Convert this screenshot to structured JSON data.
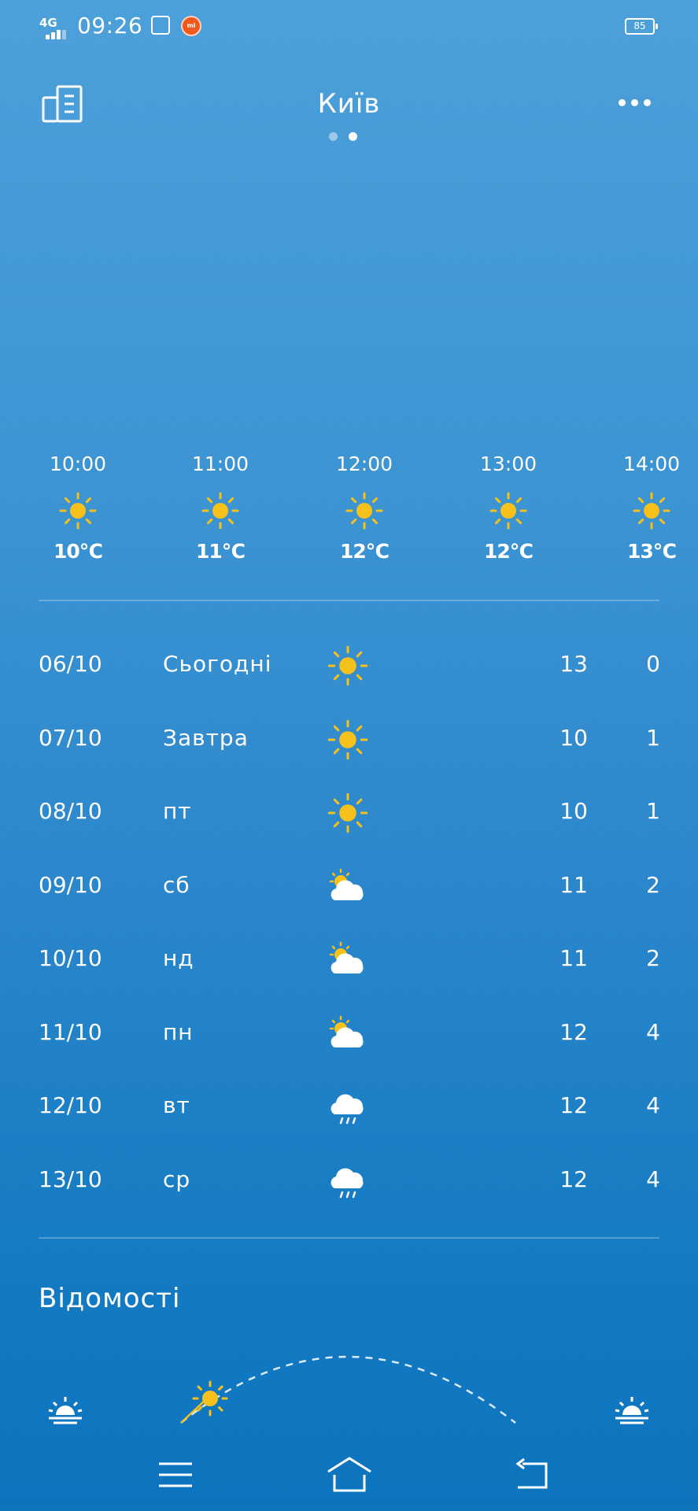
{
  "status_bar": {
    "network": "4G",
    "time": "09:26",
    "battery": "85",
    "mi_label": "mi"
  },
  "header": {
    "city": "Київ",
    "page_count": 2,
    "active_page": 2
  },
  "hourly": [
    {
      "time": "10:00",
      "icon": "sun-icon",
      "temp": "10℃"
    },
    {
      "time": "11:00",
      "icon": "sun-icon",
      "temp": "11℃"
    },
    {
      "time": "12:00",
      "icon": "sun-icon",
      "temp": "12℃"
    },
    {
      "time": "13:00",
      "icon": "sun-icon",
      "temp": "12℃"
    },
    {
      "time": "14:00",
      "icon": "sun-icon",
      "temp": "13℃"
    }
  ],
  "daily": [
    {
      "date": "06/10",
      "day": "Сьогодні",
      "icon": "sun-icon",
      "high": "13",
      "low": "0"
    },
    {
      "date": "07/10",
      "day": "Завтра",
      "icon": "sun-icon",
      "high": "10",
      "low": "1"
    },
    {
      "date": "08/10",
      "day": "пт",
      "icon": "sun-icon",
      "high": "10",
      "low": "1"
    },
    {
      "date": "09/10",
      "day": "сб",
      "icon": "partly-cloudy-icon",
      "high": "11",
      "low": "2"
    },
    {
      "date": "10/10",
      "day": "нд",
      "icon": "partly-cloudy-icon",
      "high": "11",
      "low": "2"
    },
    {
      "date": "11/10",
      "day": "пн",
      "icon": "partly-cloudy-icon",
      "high": "12",
      "low": "4"
    },
    {
      "date": "12/10",
      "day": "вт",
      "icon": "rain-icon",
      "high": "12",
      "low": "4"
    },
    {
      "date": "13/10",
      "day": "ср",
      "icon": "rain-icon",
      "high": "12",
      "low": "4"
    }
  ],
  "info": {
    "title": "Відомості"
  },
  "colors": {
    "sun": "#f5c11a",
    "accent": "#ffffff",
    "bg_top": "#4da0d9",
    "bg_bottom": "#0c74bd"
  }
}
